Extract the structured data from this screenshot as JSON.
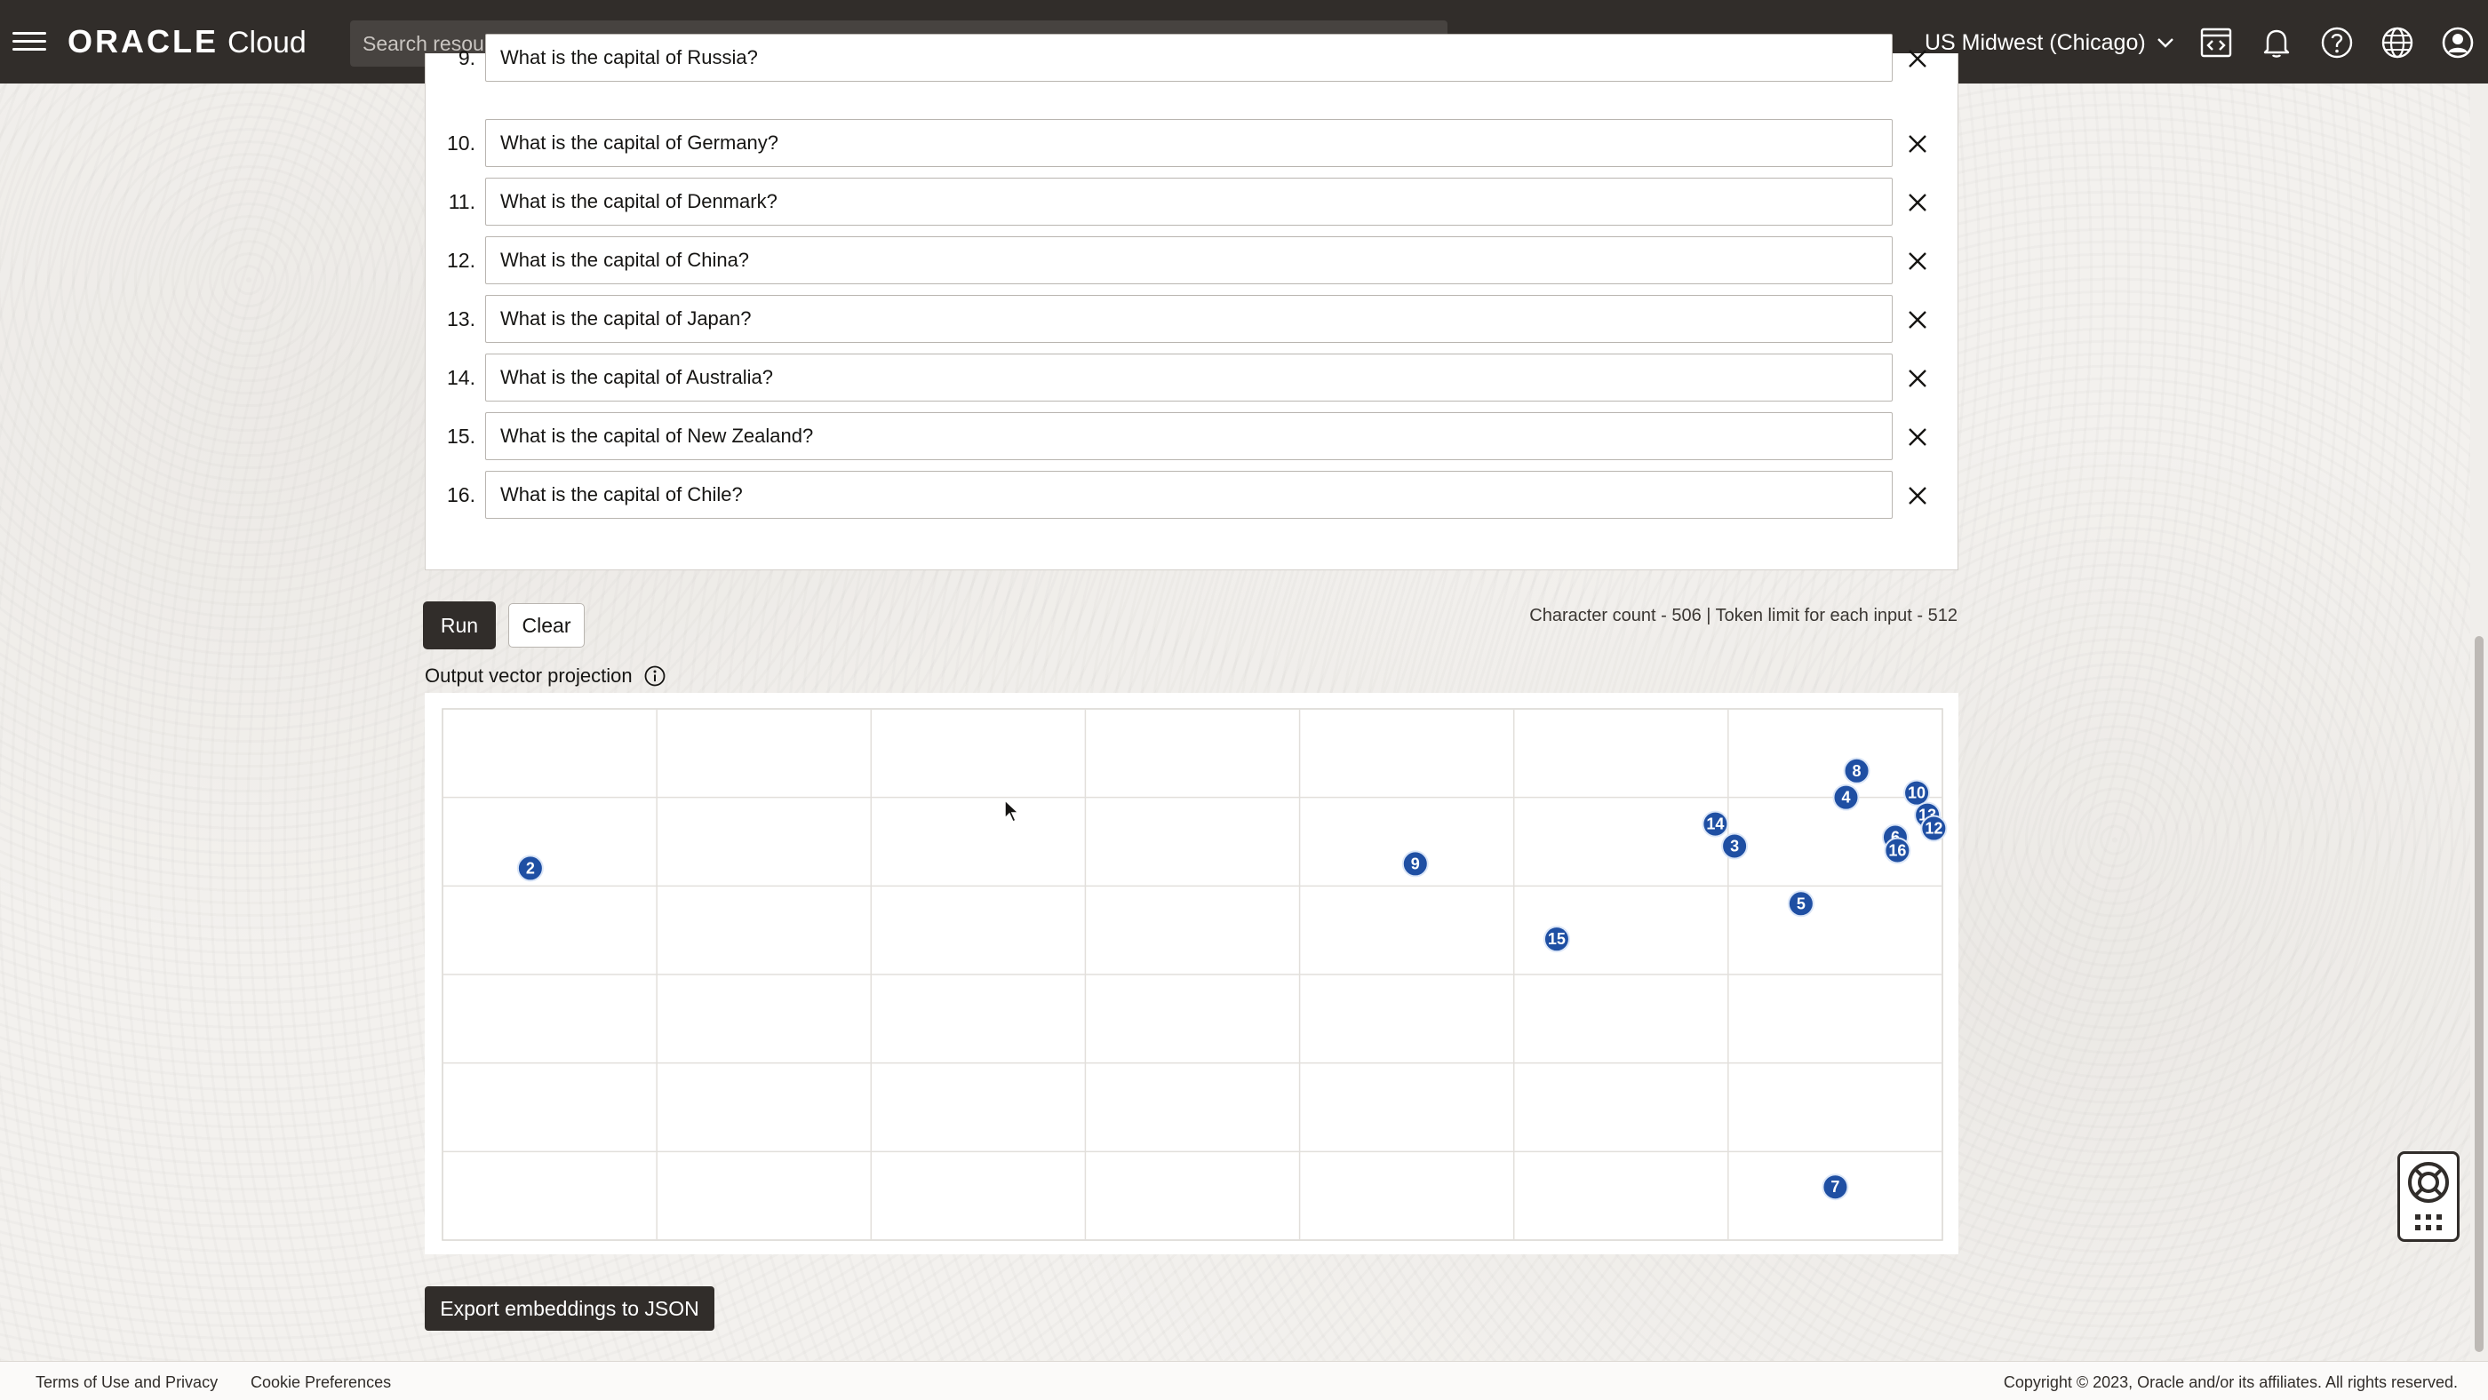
{
  "header": {
    "brand_oracle": "ORACLE",
    "brand_cloud": "Cloud",
    "search_placeholder": "Search resources, services, documentation, and Marketplace",
    "region": "US Midwest (Chicago)",
    "icons": [
      "menu-icon",
      "code-editor-icon",
      "bell-icon",
      "help-icon",
      "globe-icon",
      "profile-icon"
    ]
  },
  "questions": [
    {
      "num": "9.",
      "text": "What is the capital of Russia?"
    },
    {
      "num": "10.",
      "text": "What is the capital of Germany?"
    },
    {
      "num": "11.",
      "text": "What is the capital of Denmark?"
    },
    {
      "num": "12.",
      "text": "What is the capital of China?"
    },
    {
      "num": "13.",
      "text": "What is the capital of Japan?"
    },
    {
      "num": "14.",
      "text": "What is the capital of Australia?"
    },
    {
      "num": "15.",
      "text": "What is the capital of New Zealand?"
    },
    {
      "num": "16.",
      "text": "What is the capital of Chile?"
    }
  ],
  "actions": {
    "run_label": "Run",
    "clear_label": "Clear",
    "counts_text": "Character count - 506 | Token limit for each input - 512",
    "export_label": "Export embeddings to JSON"
  },
  "projection": {
    "title": "Output vector projection"
  },
  "chart_data": {
    "type": "scatter",
    "title": "",
    "grid": true,
    "xlim": [
      0,
      7
    ],
    "ylim": [
      0,
      6
    ],
    "points": [
      {
        "label": "2",
        "x": 0.41,
        "y": 4.2
      },
      {
        "label": "9",
        "x": 4.54,
        "y": 4.25
      },
      {
        "label": "15",
        "x": 5.2,
        "y": 3.4
      },
      {
        "label": "14",
        "x": 5.94,
        "y": 4.7
      },
      {
        "label": "3",
        "x": 6.03,
        "y": 4.45
      },
      {
        "label": "5",
        "x": 6.34,
        "y": 3.8
      },
      {
        "label": "4",
        "x": 6.55,
        "y": 5.0
      },
      {
        "label": "8",
        "x": 6.6,
        "y": 5.3
      },
      {
        "label": "6",
        "x": 6.78,
        "y": 4.55
      },
      {
        "label": "16",
        "x": 6.79,
        "y": 4.4
      },
      {
        "label": "10",
        "x": 6.88,
        "y": 5.05
      },
      {
        "label": "13",
        "x": 6.93,
        "y": 4.8
      },
      {
        "label": "12",
        "x": 6.96,
        "y": 4.65
      },
      {
        "label": "7",
        "x": 6.5,
        "y": 0.6
      }
    ]
  },
  "footer": {
    "terms": "Terms of Use and Privacy",
    "cookies": "Cookie Preferences",
    "copyright": "Copyright © 2023, Oracle and/or its affiliates. All rights reserved."
  }
}
